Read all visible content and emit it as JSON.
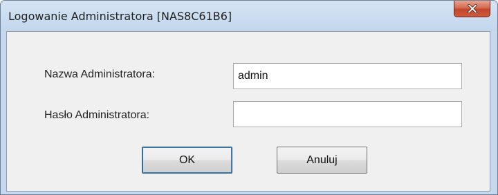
{
  "window": {
    "title": "Logowanie Administratora [NAS8C61B6]",
    "close_icon": "close-x-icon",
    "close_glyph": "✕"
  },
  "form": {
    "username_label": "Nazwa Administratora:",
    "username_value": "admin",
    "password_label": "Hasło Administratora:",
    "password_value": ""
  },
  "buttons": {
    "ok_label": "OK",
    "cancel_label": "Anuluj"
  },
  "colors": {
    "frame": "#c5d8ee",
    "close_button": "#c24529",
    "client_background": "#f0f0f0"
  }
}
